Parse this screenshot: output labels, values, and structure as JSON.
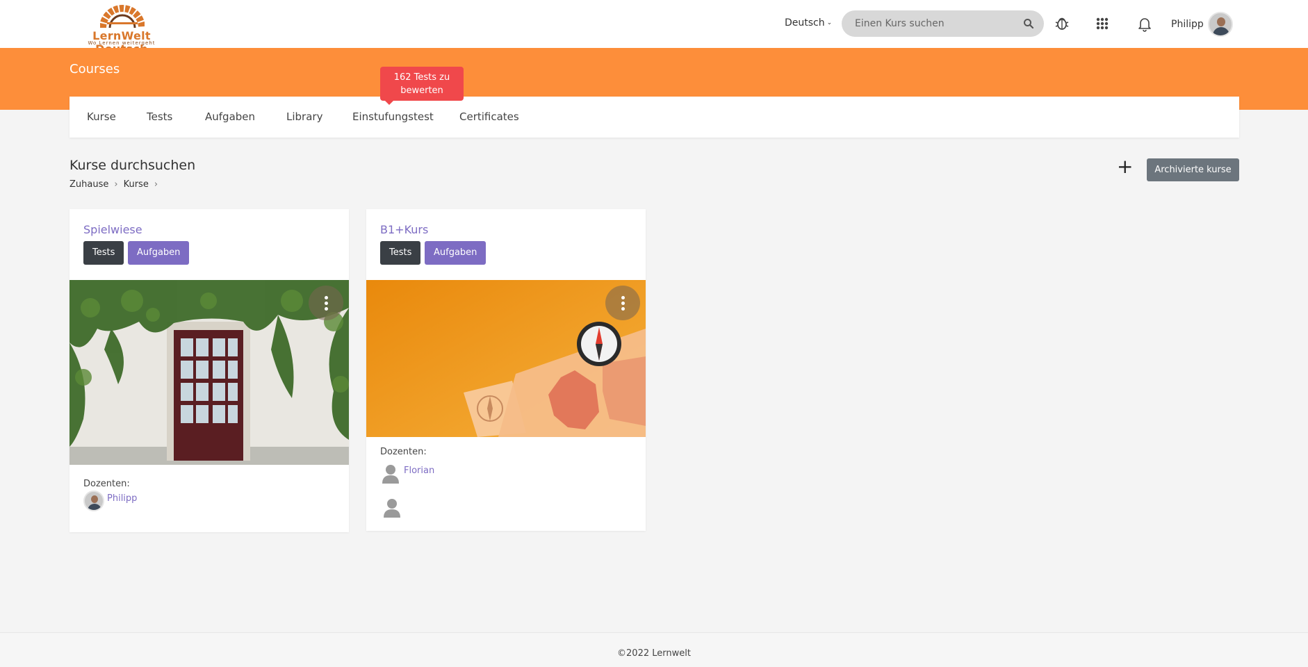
{
  "header": {
    "logo_text": "LernWelt Deutsch",
    "logo_tagline": "Wo Lernen weitergeht",
    "language": "Deutsch",
    "search_placeholder": "Einen Kurs suchen",
    "user_name": "Philipp"
  },
  "banner": {
    "title": "Courses"
  },
  "tabs": [
    {
      "label": "Kurse"
    },
    {
      "label": "Tests"
    },
    {
      "label": "Aufgaben"
    },
    {
      "label": "Library"
    },
    {
      "label": "Einstufungstest"
    },
    {
      "label": "Certificates"
    }
  ],
  "tooltip": {
    "text": "162 Tests zu bewerten"
  },
  "page": {
    "heading": "Kurse durchsuchen",
    "breadcrumb": [
      "Zuhause",
      "Kurse"
    ],
    "archived_button": "Archivierte kurse"
  },
  "courses": [
    {
      "title": "Spielwiese",
      "tests_label": "Tests",
      "tasks_label": "Aufgaben",
      "lecturers_label": "Dozenten:",
      "lecturers": [
        "Philipp"
      ]
    },
    {
      "title": "B1+Kurs",
      "tests_label": "Tests",
      "tasks_label": "Aufgaben",
      "lecturers_label": "Dozenten:",
      "lecturers": [
        "Florian"
      ]
    }
  ],
  "footer": {
    "text": "©2022 Lernwelt"
  },
  "colors": {
    "brand_orange": "#fd8e3a",
    "accent_purple": "#7d6cc3",
    "badge_red": "#f0484b",
    "dark_button": "#3a3f45"
  }
}
